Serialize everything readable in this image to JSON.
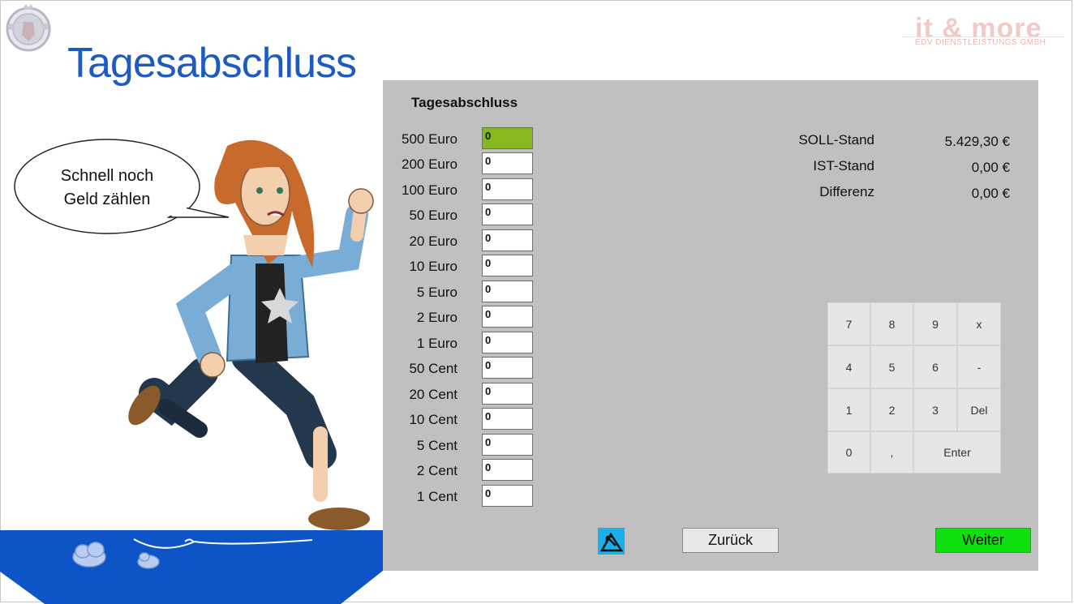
{
  "slide": {
    "title": "Tagesabschluss",
    "brand": {
      "name": "it & more",
      "subtitle": "EDV DIENSTLEISTUNGS GMBH"
    },
    "speech_bubble": {
      "line1": "Schnell noch",
      "line2": "Geld zählen"
    }
  },
  "panel": {
    "title": "Tagesabschluss",
    "denominations": [
      {
        "label": "500 Euro",
        "value": "0",
        "active": true
      },
      {
        "label": "200 Euro",
        "value": "0"
      },
      {
        "label": "100 Euro",
        "value": "0"
      },
      {
        "label": "50 Euro",
        "value": "0"
      },
      {
        "label": "20 Euro",
        "value": "0"
      },
      {
        "label": "10 Euro",
        "value": "0"
      },
      {
        "label": "5 Euro",
        "value": "0"
      },
      {
        "label": "2 Euro",
        "value": "0"
      },
      {
        "label": "1 Euro",
        "value": "0"
      },
      {
        "label": "50 Cent",
        "value": "0"
      },
      {
        "label": "20 Cent",
        "value": "0"
      },
      {
        "label": "10 Cent",
        "value": "0"
      },
      {
        "label": "5 Cent",
        "value": "0"
      },
      {
        "label": "2 Cent",
        "value": "0"
      },
      {
        "label": "1 Cent",
        "value": "0"
      }
    ],
    "summary": {
      "soll_label": "SOLL-Stand",
      "soll_value": "5.429,30 €",
      "ist_label": "IST-Stand",
      "ist_value": "0,00 €",
      "diff_label": "Differenz",
      "diff_value": "0,00 €"
    },
    "keypad": {
      "k7": "7",
      "k8": "8",
      "k9": "9",
      "kx": "x",
      "k4": "4",
      "k5": "5",
      "k6": "6",
      "kminus": "-",
      "k1": "1",
      "k2": "2",
      "k3": "3",
      "kdel": "Del",
      "k0": "0",
      "kcomma": ",",
      "kenter": "Enter"
    },
    "buttons": {
      "back": "Zurück",
      "next": "Weiter"
    }
  },
  "colors": {
    "title_blue": "#1f5bbf",
    "panel_gray": "#c0c0c0",
    "active_input_green": "#86b91f",
    "next_button_green": "#10e010",
    "floor_blue": "#0d55c6"
  }
}
